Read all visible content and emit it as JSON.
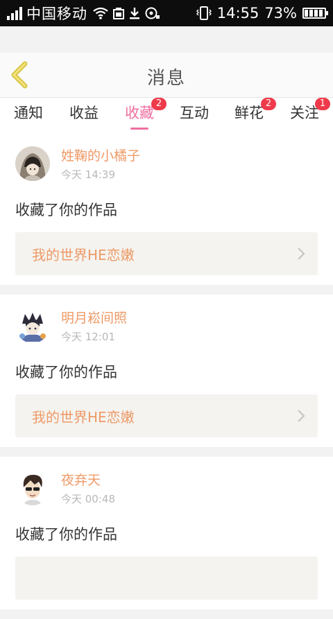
{
  "status_bar": {
    "carrier": "中国移动",
    "time": "14:55",
    "battery": "73%"
  },
  "header": {
    "title": "消息",
    "back_icon": "chevron-left-icon",
    "accent": "#e8d45c"
  },
  "tabs": [
    {
      "label": "通知",
      "badge": ""
    },
    {
      "label": "收益",
      "badge": ""
    },
    {
      "label": "收藏",
      "badge": "2",
      "active": true
    },
    {
      "label": "互动",
      "badge": ""
    },
    {
      "label": "鲜花",
      "badge": "2"
    },
    {
      "label": "关注",
      "badge": "1"
    }
  ],
  "colors": {
    "active_tab": "#ee6fa0",
    "badge": "#ee3a4a",
    "username": "#ee9a67"
  },
  "notifications": [
    {
      "username": "姓鞠的小橘子",
      "time": "今天 14:39",
      "action": "收藏了你的作品",
      "work_title": "我的世界HE恋嫩"
    },
    {
      "username": "明月崧间照",
      "time": "今天 12:01",
      "action": "收藏了你的作品",
      "work_title": "我的世界HE恋嫩"
    },
    {
      "username": "夜弃天",
      "time": "今天 00:48",
      "action": "收藏了你的作品",
      "work_title": ""
    }
  ]
}
